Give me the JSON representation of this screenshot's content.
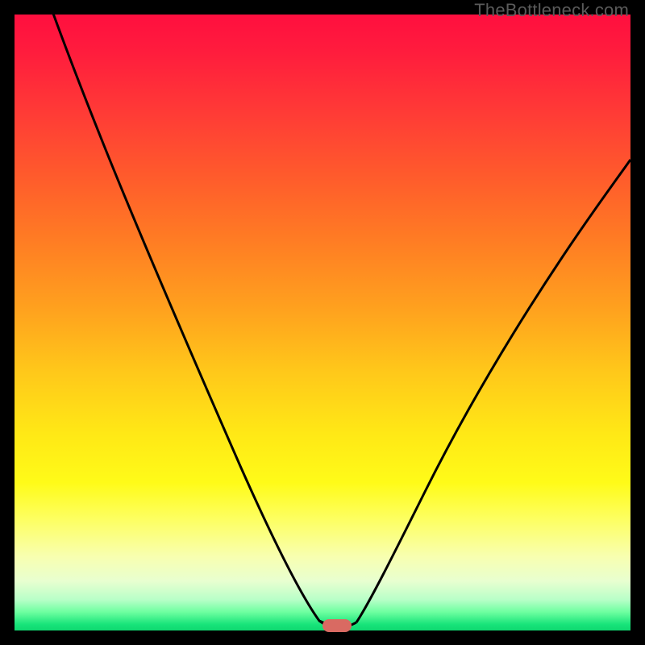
{
  "attribution": "TheBottleneck.com",
  "colors": {
    "frame": "#000000",
    "curve": "#000000",
    "marker": "#d96a62",
    "gradient_stops": [
      "#ff0f3f",
      "#ff1c3d",
      "#ff3b36",
      "#ff5a2c",
      "#ff7a24",
      "#ffa21e",
      "#ffc81a",
      "#ffe816",
      "#fffb18",
      "#fdff62",
      "#f8ffb0",
      "#e8ffd0",
      "#b8ffc8",
      "#6effa0",
      "#18e47a",
      "#0fd870"
    ]
  },
  "chart_data": {
    "type": "line",
    "title": "",
    "xlabel": "",
    "ylabel": "",
    "xlim": [
      0,
      100
    ],
    "ylim": [
      0,
      100
    ],
    "grid": false,
    "legend": false,
    "series": [
      {
        "name": "bottleneck-curve-left",
        "x": [
          0,
          3,
          6,
          10,
          14,
          18,
          22,
          26,
          30,
          34,
          38,
          42,
          46,
          49,
          51,
          53
        ],
        "y": [
          115,
          107,
          99,
          89,
          80,
          72,
          64,
          56,
          48,
          39,
          30,
          21,
          11,
          3,
          0.5,
          0.5
        ]
      },
      {
        "name": "bottleneck-curve-right",
        "x": [
          53,
          55,
          58,
          62,
          66,
          70,
          74,
          78,
          82,
          86,
          90,
          94,
          98,
          100
        ],
        "y": [
          0.5,
          2,
          8,
          17,
          25,
          33,
          40,
          47,
          53,
          59,
          65,
          70,
          75,
          78
        ]
      }
    ],
    "marker": {
      "x": 52,
      "y": 0.5,
      "shape": "pill"
    },
    "background": {
      "type": "vertical-gradient",
      "meaning": "red=high bottleneck, green=low bottleneck"
    }
  }
}
